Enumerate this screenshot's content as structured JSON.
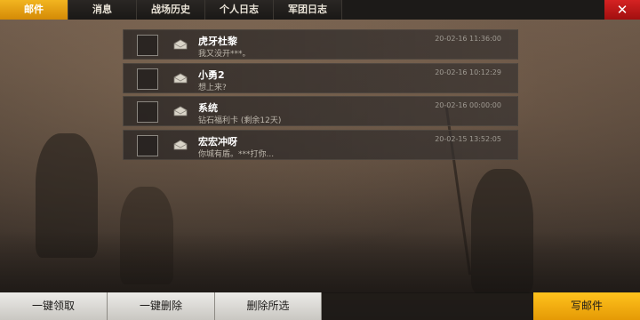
{
  "tabs": [
    {
      "label": "邮件",
      "active": true
    },
    {
      "label": "消息",
      "active": false
    },
    {
      "label": "战场历史",
      "active": false
    },
    {
      "label": "个人日志",
      "active": false
    },
    {
      "label": "军团日志",
      "active": false
    }
  ],
  "close_icon": "✕",
  "mails": [
    {
      "sender": "虎牙杜黎",
      "preview": "我又没开***。",
      "time": "20-02-16 11:36:00"
    },
    {
      "sender": "小勇2",
      "preview": "想上来?",
      "time": "20-02-16 10:12:29"
    },
    {
      "sender": "系统",
      "preview": "钻石福利卡 (剩余12天)",
      "time": "20-02-16 00:00:00"
    },
    {
      "sender": "宏宏冲呀",
      "preview": "你城有盾。***打你...",
      "time": "20-02-15 13:52:05"
    }
  ],
  "actions": {
    "claim_all": "一键领取",
    "delete_all": "一键删除",
    "delete_selected": "删除所选",
    "write_mail": "写邮件"
  },
  "colors": {
    "active_tab": "#e8a010",
    "close": "#c31818",
    "primary_button": "#f4ad12"
  }
}
